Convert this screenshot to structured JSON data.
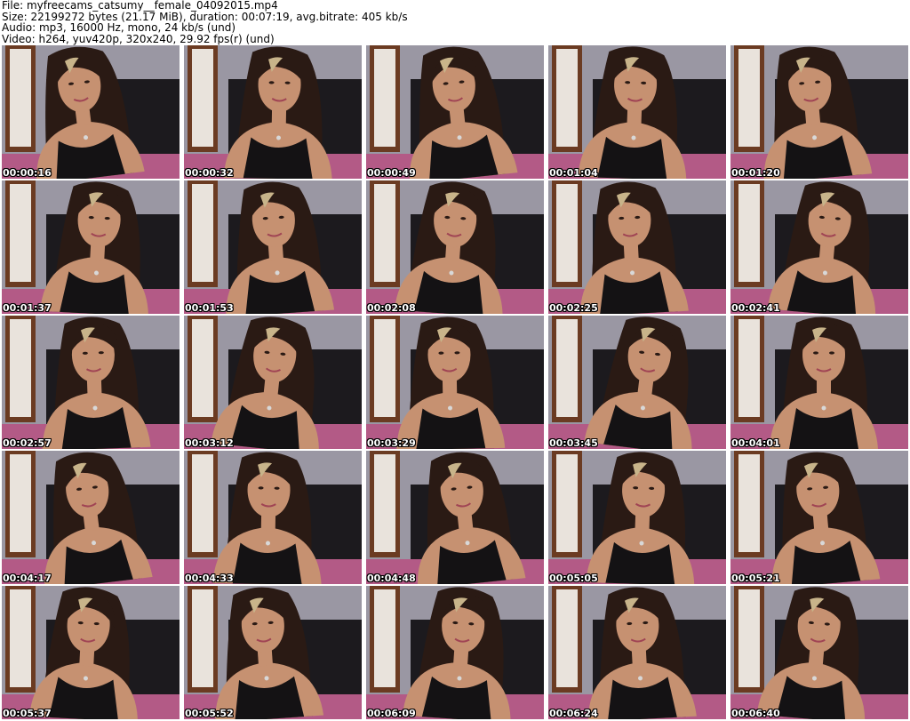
{
  "header": {
    "file_line": "File: myfreecams_catsumy__female_04092015.mp4",
    "size_line": "Size: 22199272 bytes (21.17 MiB), duration: 00:07:19, avg.bitrate: 405 kb/s",
    "audio_line": "Audio: mp3, 16000 Hz, mono, 24 kb/s (und)",
    "video_line": "Video: h264, yuv420p, 320x240, 29.92 fps(r) (und)"
  },
  "thumbnails": [
    {
      "timestamp": "00:00:16"
    },
    {
      "timestamp": "00:00:32"
    },
    {
      "timestamp": "00:00:49"
    },
    {
      "timestamp": "00:01:04"
    },
    {
      "timestamp": "00:01:20"
    },
    {
      "timestamp": "00:01:37"
    },
    {
      "timestamp": "00:01:53"
    },
    {
      "timestamp": "00:02:08"
    },
    {
      "timestamp": "00:02:25"
    },
    {
      "timestamp": "00:02:41"
    },
    {
      "timestamp": "00:02:57"
    },
    {
      "timestamp": "00:03:12"
    },
    {
      "timestamp": "00:03:29"
    },
    {
      "timestamp": "00:03:45"
    },
    {
      "timestamp": "00:04:01"
    },
    {
      "timestamp": "00:04:17"
    },
    {
      "timestamp": "00:04:33"
    },
    {
      "timestamp": "00:04:48"
    },
    {
      "timestamp": "00:05:05"
    },
    {
      "timestamp": "00:05:21"
    },
    {
      "timestamp": "00:05:37"
    },
    {
      "timestamp": "00:05:52"
    },
    {
      "timestamp": "00:06:09"
    },
    {
      "timestamp": "00:06:24"
    },
    {
      "timestamp": "00:06:40"
    }
  ],
  "colors": {
    "wall": "#9a97a3",
    "headboard": "#1c1a1e",
    "shelf": "#6b3b22",
    "bedspread": "#b35a86",
    "skin": "#c69171",
    "hair": "#2a1a14",
    "hair_highlight": "#c8b48a",
    "top": "#141214"
  }
}
